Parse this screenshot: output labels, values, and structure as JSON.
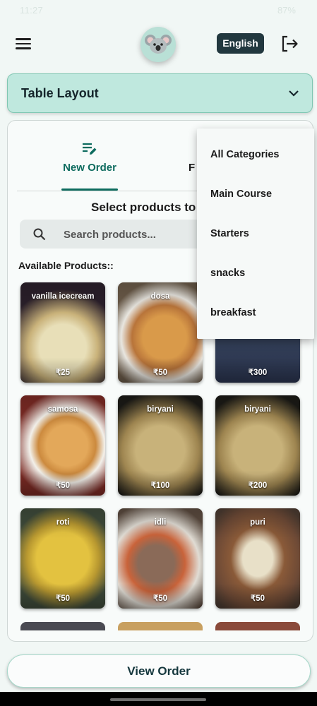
{
  "status_bar": {
    "time": "11:27",
    "battery": "87%"
  },
  "header": {
    "language_label": "English"
  },
  "table_layout": {
    "label": "Table Layout"
  },
  "tabs": [
    {
      "label": "New Order",
      "active": true
    },
    {
      "label": "F",
      "active": false
    }
  ],
  "section_title": "Select products to",
  "search": {
    "placeholder": "Search products..."
  },
  "available_label": "Available Products::",
  "products": [
    {
      "name": "vanilla icecream",
      "price": "₹25"
    },
    {
      "name": "dosa",
      "price": "₹50"
    },
    {
      "name": "",
      "price": "₹300"
    },
    {
      "name": "samosa",
      "price": "₹50"
    },
    {
      "name": "biryani",
      "price": "₹100"
    },
    {
      "name": "biryani",
      "price": "₹200"
    },
    {
      "name": "roti",
      "price": "₹50"
    },
    {
      "name": "idli",
      "price": "₹50"
    },
    {
      "name": "puri",
      "price": "₹50"
    }
  ],
  "category_menu": {
    "options": [
      "All Categories",
      "Main Course",
      "Starters",
      "snacks",
      "breakfast"
    ]
  },
  "view_order_label": "View Order",
  "colors": {
    "accent": "#0d6b5e",
    "banner": "#bfe8de",
    "language_bg": "#22383f"
  }
}
